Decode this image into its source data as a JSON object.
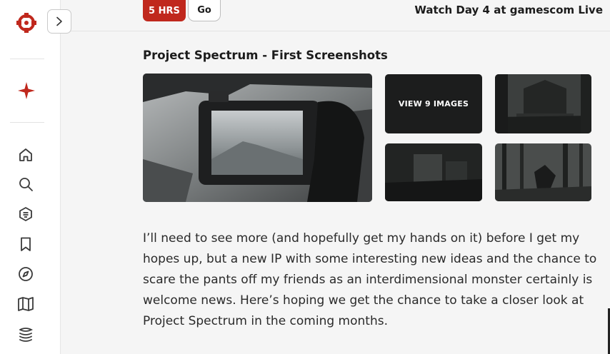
{
  "topbar": {
    "badge": "5 HRS",
    "go_label": "Go",
    "watch_link": "Watch Day 4 at gamescom Live"
  },
  "sidebar": {
    "items": [
      {
        "icon": "home-icon"
      },
      {
        "icon": "search-icon"
      },
      {
        "icon": "shield-icon"
      },
      {
        "icon": "bookmark-icon"
      },
      {
        "icon": "compass-icon"
      },
      {
        "icon": "map-icon"
      },
      {
        "icon": "stack-icon"
      }
    ]
  },
  "gallery": {
    "title": "Project Spectrum - First Screenshots",
    "view_label": "VIEW 9 IMAGES"
  },
  "article": {
    "paragraph": "I’ll need to see more (and hopefully get my hands on it) before I get my hopes up, but a new IP with some interesting new ideas and the chance to scare the pants off my friends as an interdimensional monster certainly is welcome news. Here’s hoping we get the chance to take a closer look at Project Spectrum in the coming months."
  },
  "colors": {
    "accent": "#c0281d",
    "background": "#f5f5f5",
    "sidebar": "#ffffff"
  }
}
